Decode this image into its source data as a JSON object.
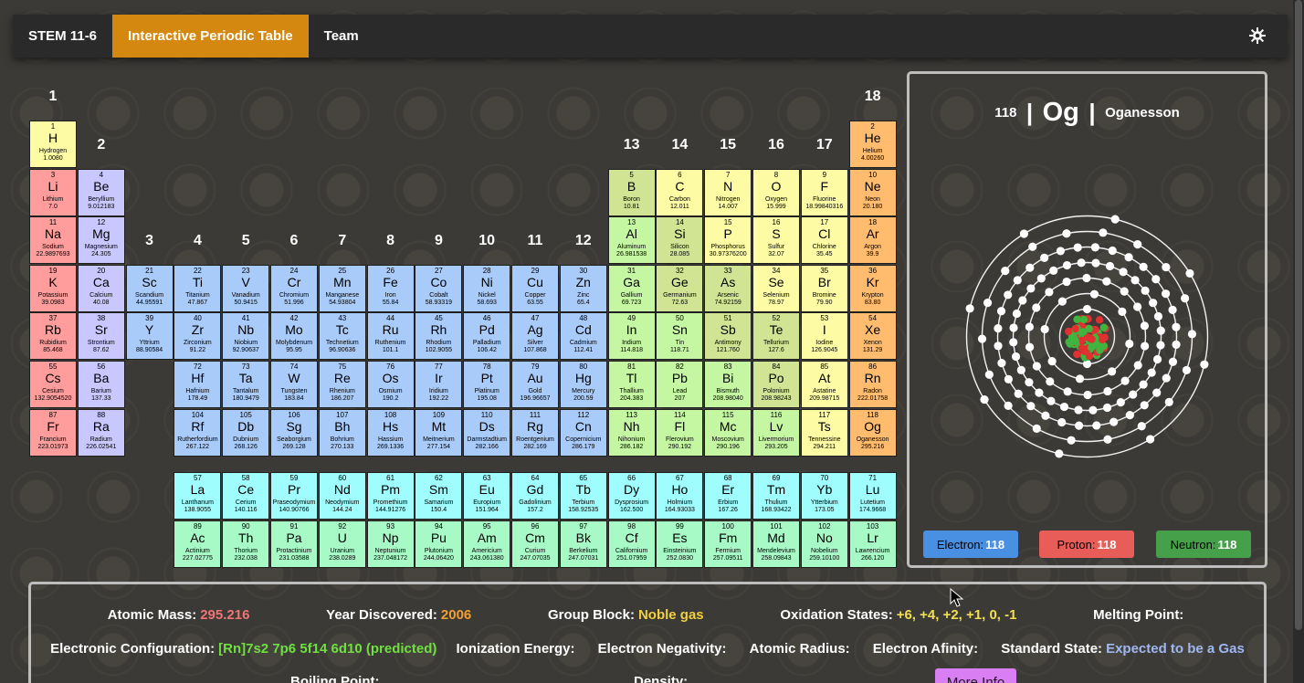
{
  "nav": {
    "items": [
      "STEM 11-6",
      "Interactive Periodic Table",
      "Team"
    ],
    "active": 1,
    "theme_icon": "gear-icon"
  },
  "colors": {
    "accent": "#d4880f",
    "alkali": "#ff9d9d",
    "alkaline": "#c8c8ff",
    "transition": "#a8cbfa",
    "post": "#c5f7a3",
    "metalloid": "#d0e494",
    "nonmetal": "#fdfca4",
    "noble": "#ffbb6e",
    "lanthanide": "#a0fdfe",
    "actinide": "#a7f9c5"
  },
  "group_labels": [
    "1",
    "2",
    "3",
    "4",
    "5",
    "6",
    "7",
    "8",
    "9",
    "10",
    "11",
    "12",
    "13",
    "14",
    "15",
    "16",
    "17",
    "18"
  ],
  "elements": [
    [
      1,
      "H",
      "Hydrogen",
      "1.0080",
      1,
      1,
      "nonmetal"
    ],
    [
      2,
      "He",
      "Helium",
      "4.00260",
      18,
      1,
      "noble"
    ],
    [
      3,
      "Li",
      "Lithium",
      "7.0",
      1,
      2,
      "alkali"
    ],
    [
      4,
      "Be",
      "Beryllium",
      "9.012183",
      2,
      2,
      "alkaline"
    ],
    [
      5,
      "B",
      "Boron",
      "10.81",
      13,
      2,
      "metalloid"
    ],
    [
      6,
      "C",
      "Carbon",
      "12.011",
      14,
      2,
      "nonmetal"
    ],
    [
      7,
      "N",
      "Nitrogen",
      "14.007",
      15,
      2,
      "nonmetal"
    ],
    [
      8,
      "O",
      "Oxygen",
      "15.999",
      16,
      2,
      "nonmetal"
    ],
    [
      9,
      "F",
      "Fluorine",
      "18.99840316",
      17,
      2,
      "nonmetal"
    ],
    [
      10,
      "Ne",
      "Neon",
      "20.180",
      18,
      2,
      "noble"
    ],
    [
      11,
      "Na",
      "Sodium",
      "22.9897693",
      1,
      3,
      "alkali"
    ],
    [
      12,
      "Mg",
      "Magnesium",
      "24.305",
      2,
      3,
      "alkaline"
    ],
    [
      13,
      "Al",
      "Aluminum",
      "26.981538",
      13,
      3,
      "post"
    ],
    [
      14,
      "Si",
      "Silicon",
      "28.085",
      14,
      3,
      "metalloid"
    ],
    [
      15,
      "P",
      "Phosphorus",
      "30.97376200",
      15,
      3,
      "nonmetal"
    ],
    [
      16,
      "S",
      "Sulfur",
      "32.07",
      16,
      3,
      "nonmetal"
    ],
    [
      17,
      "Cl",
      "Chlorine",
      "35.45",
      17,
      3,
      "nonmetal"
    ],
    [
      18,
      "Ar",
      "Argon",
      "39.9",
      18,
      3,
      "noble"
    ],
    [
      19,
      "K",
      "Potassium",
      "39.0983",
      1,
      4,
      "alkali"
    ],
    [
      20,
      "Ca",
      "Calcium",
      "40.08",
      2,
      4,
      "alkaline"
    ],
    [
      21,
      "Sc",
      "Scandium",
      "44.95591",
      3,
      4,
      "transition"
    ],
    [
      22,
      "Ti",
      "Titanium",
      "47.867",
      4,
      4,
      "transition"
    ],
    [
      23,
      "V",
      "Vanadium",
      "50.9415",
      5,
      4,
      "transition"
    ],
    [
      24,
      "Cr",
      "Chromium",
      "51.996",
      6,
      4,
      "transition"
    ],
    [
      25,
      "Mn",
      "Manganese",
      "54.93804",
      7,
      4,
      "transition"
    ],
    [
      26,
      "Fe",
      "Iron",
      "55.84",
      8,
      4,
      "transition"
    ],
    [
      27,
      "Co",
      "Cobalt",
      "58.93319",
      9,
      4,
      "transition"
    ],
    [
      28,
      "Ni",
      "Nickel",
      "58.693",
      10,
      4,
      "transition"
    ],
    [
      29,
      "Cu",
      "Copper",
      "63.55",
      11,
      4,
      "transition"
    ],
    [
      30,
      "Zn",
      "Zinc",
      "65.4",
      12,
      4,
      "transition"
    ],
    [
      31,
      "Ga",
      "Gallium",
      "69.723",
      13,
      4,
      "post"
    ],
    [
      32,
      "Ge",
      "Germanium",
      "72.63",
      14,
      4,
      "metalloid"
    ],
    [
      33,
      "As",
      "Arsenic",
      "74.92159",
      15,
      4,
      "metalloid"
    ],
    [
      34,
      "Se",
      "Selenium",
      "78.97",
      16,
      4,
      "nonmetal"
    ],
    [
      35,
      "Br",
      "Bromine",
      "79.90",
      17,
      4,
      "nonmetal"
    ],
    [
      36,
      "Kr",
      "Krypton",
      "83.80",
      18,
      4,
      "noble"
    ],
    [
      37,
      "Rb",
      "Rubidium",
      "85.468",
      1,
      5,
      "alkali"
    ],
    [
      38,
      "Sr",
      "Strontium",
      "87.62",
      2,
      5,
      "alkaline"
    ],
    [
      39,
      "Y",
      "Yttrium",
      "88.90584",
      3,
      5,
      "transition"
    ],
    [
      40,
      "Zr",
      "Zirconium",
      "91.22",
      4,
      5,
      "transition"
    ],
    [
      41,
      "Nb",
      "Niobium",
      "92.90637",
      5,
      5,
      "transition"
    ],
    [
      42,
      "Mo",
      "Molybdenum",
      "95.95",
      6,
      5,
      "transition"
    ],
    [
      43,
      "Tc",
      "Technetium",
      "96.90636",
      7,
      5,
      "transition"
    ],
    [
      44,
      "Ru",
      "Ruthenium",
      "101.1",
      8,
      5,
      "transition"
    ],
    [
      45,
      "Rh",
      "Rhodium",
      "102.9055",
      9,
      5,
      "transition"
    ],
    [
      46,
      "Pd",
      "Palladium",
      "106.42",
      10,
      5,
      "transition"
    ],
    [
      47,
      "Ag",
      "Silver",
      "107.868",
      11,
      5,
      "transition"
    ],
    [
      48,
      "Cd",
      "Cadmium",
      "112.41",
      12,
      5,
      "transition"
    ],
    [
      49,
      "In",
      "Indium",
      "114.818",
      13,
      5,
      "post"
    ],
    [
      50,
      "Sn",
      "Tin",
      "118.71",
      14,
      5,
      "post"
    ],
    [
      51,
      "Sb",
      "Antimony",
      "121.760",
      15,
      5,
      "metalloid"
    ],
    [
      52,
      "Te",
      "Tellurium",
      "127.6",
      16,
      5,
      "metalloid"
    ],
    [
      53,
      "I",
      "Iodine",
      "126.9045",
      17,
      5,
      "nonmetal"
    ],
    [
      54,
      "Xe",
      "Xenon",
      "131.29",
      18,
      5,
      "noble"
    ],
    [
      55,
      "Cs",
      "Cesium",
      "132.9054520",
      1,
      6,
      "alkali"
    ],
    [
      56,
      "Ba",
      "Barium",
      "137.33",
      2,
      6,
      "alkaline"
    ],
    [
      72,
      "Hf",
      "Hafnium",
      "178.49",
      4,
      6,
      "transition"
    ],
    [
      73,
      "Ta",
      "Tantalum",
      "180.9479",
      5,
      6,
      "transition"
    ],
    [
      74,
      "W",
      "Tungsten",
      "183.84",
      6,
      6,
      "transition"
    ],
    [
      75,
      "Re",
      "Rhenium",
      "186.207",
      7,
      6,
      "transition"
    ],
    [
      76,
      "Os",
      "Osmium",
      "190.2",
      8,
      6,
      "transition"
    ],
    [
      77,
      "Ir",
      "Iridium",
      "192.22",
      9,
      6,
      "transition"
    ],
    [
      78,
      "Pt",
      "Platinum",
      "195.08",
      10,
      6,
      "transition"
    ],
    [
      79,
      "Au",
      "Gold",
      "196.96657",
      11,
      6,
      "transition"
    ],
    [
      80,
      "Hg",
      "Mercury",
      "200.59",
      12,
      6,
      "transition"
    ],
    [
      81,
      "Tl",
      "Thallium",
      "204.383",
      13,
      6,
      "post"
    ],
    [
      82,
      "Pb",
      "Lead",
      "207",
      14,
      6,
      "post"
    ],
    [
      83,
      "Bi",
      "Bismuth",
      "208.98040",
      15,
      6,
      "post"
    ],
    [
      84,
      "Po",
      "Polonium",
      "208.98243",
      16,
      6,
      "metalloid"
    ],
    [
      85,
      "At",
      "Astatine",
      "209.98715",
      17,
      6,
      "nonmetal"
    ],
    [
      86,
      "Rn",
      "Radon",
      "222.01758",
      18,
      6,
      "noble"
    ],
    [
      87,
      "Fr",
      "Francium",
      "223.01973",
      1,
      7,
      "alkali"
    ],
    [
      88,
      "Ra",
      "Radium",
      "226.02541",
      2,
      7,
      "alkaline"
    ],
    [
      104,
      "Rf",
      "Rutherfordium",
      "267.122",
      4,
      7,
      "transition"
    ],
    [
      105,
      "Db",
      "Dubnium",
      "268.126",
      5,
      7,
      "transition"
    ],
    [
      106,
      "Sg",
      "Seaborgium",
      "269.128",
      6,
      7,
      "transition"
    ],
    [
      107,
      "Bh",
      "Bohrium",
      "270.133",
      7,
      7,
      "transition"
    ],
    [
      108,
      "Hs",
      "Hassium",
      "269.1336",
      8,
      7,
      "transition"
    ],
    [
      109,
      "Mt",
      "Meitnerium",
      "277.154",
      9,
      7,
      "transition"
    ],
    [
      110,
      "Ds",
      "Darmstadtium",
      "282.166",
      10,
      7,
      "transition"
    ],
    [
      111,
      "Rg",
      "Roentgenium",
      "282.169",
      11,
      7,
      "transition"
    ],
    [
      112,
      "Cn",
      "Copernicium",
      "286.179",
      12,
      7,
      "transition"
    ],
    [
      113,
      "Nh",
      "Nihonium",
      "286.182",
      13,
      7,
      "post"
    ],
    [
      114,
      "Fl",
      "Flerovium",
      "290.192",
      14,
      7,
      "post"
    ],
    [
      115,
      "Mc",
      "Moscovium",
      "290.196",
      15,
      7,
      "post"
    ],
    [
      116,
      "Lv",
      "Livermorium",
      "293.205",
      16,
      7,
      "post"
    ],
    [
      117,
      "Ts",
      "Tennessine",
      "294.211",
      17,
      7,
      "nonmetal"
    ],
    [
      118,
      "Og",
      "Oganesson",
      "295.216",
      18,
      7,
      "noble"
    ],
    [
      57,
      "La",
      "Lanthanum",
      "138.9055",
      4,
      9,
      "lanthanide"
    ],
    [
      58,
      "Ce",
      "Cerium",
      "140.116",
      5,
      9,
      "lanthanide"
    ],
    [
      59,
      "Pr",
      "Praseodymium",
      "140.90766",
      6,
      9,
      "lanthanide"
    ],
    [
      60,
      "Nd",
      "Neodymium",
      "144.24",
      7,
      9,
      "lanthanide"
    ],
    [
      61,
      "Pm",
      "Promethium",
      "144.91276",
      8,
      9,
      "lanthanide"
    ],
    [
      62,
      "Sm",
      "Samarium",
      "150.4",
      9,
      9,
      "lanthanide"
    ],
    [
      63,
      "Eu",
      "Europium",
      "151.964",
      10,
      9,
      "lanthanide"
    ],
    [
      64,
      "Gd",
      "Gadolinium",
      "157.2",
      11,
      9,
      "lanthanide"
    ],
    [
      65,
      "Tb",
      "Terbium",
      "158.92535",
      12,
      9,
      "lanthanide"
    ],
    [
      66,
      "Dy",
      "Dysprosium",
      "162.500",
      13,
      9,
      "lanthanide"
    ],
    [
      67,
      "Ho",
      "Holmium",
      "164.93033",
      14,
      9,
      "lanthanide"
    ],
    [
      68,
      "Er",
      "Erbium",
      "167.26",
      15,
      9,
      "lanthanide"
    ],
    [
      69,
      "Tm",
      "Thulium",
      "168.93422",
      16,
      9,
      "lanthanide"
    ],
    [
      70,
      "Yb",
      "Ytterbium",
      "173.05",
      17,
      9,
      "lanthanide"
    ],
    [
      71,
      "Lu",
      "Lutetium",
      "174.9668",
      18,
      9,
      "lanthanide"
    ],
    [
      89,
      "Ac",
      "Actinium",
      "227.02775",
      4,
      10,
      "actinide"
    ],
    [
      90,
      "Th",
      "Thorium",
      "232.038",
      5,
      10,
      "actinide"
    ],
    [
      91,
      "Pa",
      "Protactinium",
      "231.03588",
      6,
      10,
      "actinide"
    ],
    [
      92,
      "U",
      "Uranium",
      "238.0289",
      7,
      10,
      "actinide"
    ],
    [
      93,
      "Np",
      "Neptunium",
      "237.048172",
      8,
      10,
      "actinide"
    ],
    [
      94,
      "Pu",
      "Plutonium",
      "244.06420",
      9,
      10,
      "actinide"
    ],
    [
      95,
      "Am",
      "Americium",
      "243.061380",
      10,
      10,
      "actinide"
    ],
    [
      96,
      "Cm",
      "Curium",
      "247.07035",
      11,
      10,
      "actinide"
    ],
    [
      97,
      "Bk",
      "Berkelium",
      "247.07031",
      12,
      10,
      "actinide"
    ],
    [
      98,
      "Cf",
      "Californium",
      "251.07959",
      13,
      10,
      "actinide"
    ],
    [
      99,
      "Es",
      "Einsteinium",
      "252.0830",
      14,
      10,
      "actinide"
    ],
    [
      100,
      "Fm",
      "Fermium",
      "257.09511",
      15,
      10,
      "actinide"
    ],
    [
      101,
      "Md",
      "Mendelevium",
      "258.09843",
      16,
      10,
      "actinide"
    ],
    [
      102,
      "No",
      "Nobelium",
      "259.10100",
      17,
      10,
      "actinide"
    ],
    [
      103,
      "Lr",
      "Lawrencium",
      "266.120",
      18,
      10,
      "actinide"
    ]
  ],
  "selected": {
    "number": "118",
    "symbol": "Og",
    "name": "Oganesson",
    "sep": "|",
    "shells": [
      2,
      8,
      18,
      32,
      32,
      18,
      8
    ],
    "buttons": [
      {
        "label": "Electron:",
        "value": "118",
        "color": "#4a90e2"
      },
      {
        "label": "Proton:",
        "value": "118",
        "color": "#e85d57"
      },
      {
        "label": "Neutron:",
        "value": "118",
        "color": "#46a04a"
      }
    ]
  },
  "info": {
    "row1": [
      {
        "label": "Atomic Mass:",
        "value": "295.216",
        "color": "#f07575"
      },
      {
        "label": "Year Discovered:",
        "value": "2006",
        "color": "#f0a030"
      },
      {
        "label": "Group Block:",
        "value": "Noble gas",
        "color": "#f0d040"
      },
      {
        "label": "Oxidation States:",
        "value": "+6, +4, +2, +1, 0, -1",
        "color": "#f0e050"
      },
      {
        "label": "Melting Point:",
        "value": "",
        "color": "#fff"
      }
    ],
    "row2": [
      {
        "label": "Electronic Configuration:",
        "value": "[Rn]7s2 7p6 5f14 6d10 (predicted)",
        "color": "#6ee040"
      },
      {
        "label": "Ionization Energy:",
        "value": "",
        "color": "#fff"
      },
      {
        "label": "Electron Negativity:",
        "value": "",
        "color": "#fff"
      },
      {
        "label": "Atomic Radius:",
        "value": "",
        "color": "#fff"
      },
      {
        "label": "Electron Afinity:",
        "value": "",
        "color": "#fff"
      },
      {
        "label": "Standard State:",
        "value": "Expected to be a Gas",
        "color": "#9fb8f0"
      }
    ],
    "row3": [
      {
        "label": "Boiling Point:",
        "value": ""
      },
      {
        "label": "Density:",
        "value": ""
      }
    ],
    "more_label": "More Info"
  }
}
